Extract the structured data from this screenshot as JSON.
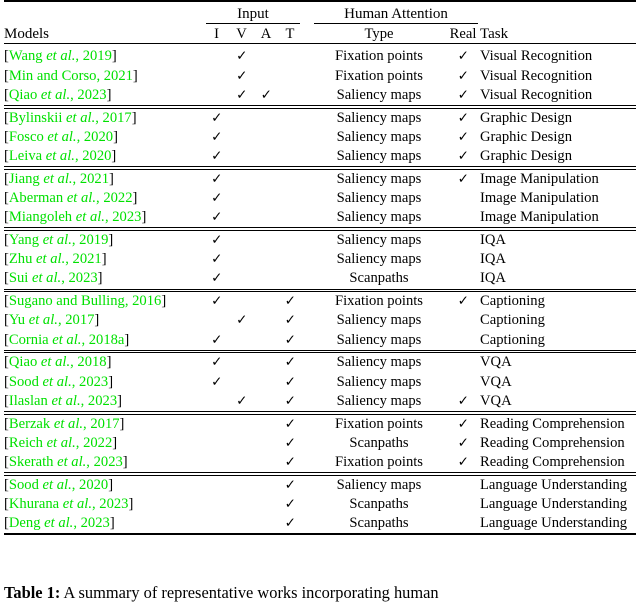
{
  "table": {
    "header": {
      "models": "Models",
      "input_group": "Input",
      "attention_group": "Human Attention",
      "input_cols": [
        "I",
        "V",
        "A",
        "T"
      ],
      "type": "Type",
      "real": "Real",
      "task": "Task"
    },
    "check_glyph": "✓",
    "citation_color": "#00e000",
    "groups": [
      {
        "rows": [
          {
            "cite_open": "[",
            "author": "Wang ",
            "etal": "et al.",
            "year": ", 2019",
            "cite_close": "]",
            "I": false,
            "V": true,
            "A": false,
            "T": false,
            "type": "Fixation points",
            "real": true,
            "task": "Visual Recognition"
          },
          {
            "cite_open": "[",
            "author": "Min and Corso",
            "etal": "",
            "year": ", 2021",
            "cite_close": "]",
            "I": false,
            "V": true,
            "A": false,
            "T": false,
            "type": "Fixation points",
            "real": true,
            "task": "Visual Recognition"
          },
          {
            "cite_open": "[",
            "author": "Qiao ",
            "etal": "et al.",
            "year": ", 2023",
            "cite_close": "]",
            "I": false,
            "V": true,
            "A": true,
            "T": false,
            "type": "Saliency maps",
            "real": true,
            "task": "Visual Recognition"
          }
        ]
      },
      {
        "rows": [
          {
            "cite_open": "[",
            "author": "Bylinskii ",
            "etal": "et al.",
            "year": ", 2017",
            "cite_close": "]",
            "I": true,
            "V": false,
            "A": false,
            "T": false,
            "type": "Saliency maps",
            "real": true,
            "task": "Graphic Design"
          },
          {
            "cite_open": "[",
            "author": "Fosco ",
            "etal": "et al.",
            "year": ", 2020",
            "cite_close": "]",
            "I": true,
            "V": false,
            "A": false,
            "T": false,
            "type": "Saliency maps",
            "real": true,
            "task": "Graphic Design"
          },
          {
            "cite_open": "[",
            "author": "Leiva ",
            "etal": "et al.",
            "year": ", 2020",
            "cite_close": "]",
            "I": true,
            "V": false,
            "A": false,
            "T": false,
            "type": "Saliency maps",
            "real": true,
            "task": "Graphic Design"
          }
        ]
      },
      {
        "rows": [
          {
            "cite_open": "[",
            "author": "Jiang ",
            "etal": "et al.",
            "year": ", 2021",
            "cite_close": "]",
            "I": true,
            "V": false,
            "A": false,
            "T": false,
            "type": "Saliency maps",
            "real": true,
            "task": "Image Manipulation"
          },
          {
            "cite_open": "[",
            "author": "Aberman ",
            "etal": "et al.",
            "year": ", 2022",
            "cite_close": "]",
            "I": true,
            "V": false,
            "A": false,
            "T": false,
            "type": "Saliency maps",
            "real": false,
            "task": "Image Manipulation"
          },
          {
            "cite_open": "[",
            "author": "Miangoleh ",
            "etal": "et al.",
            "year": ", 2023",
            "cite_close": "]",
            "I": true,
            "V": false,
            "A": false,
            "T": false,
            "type": "Saliency maps",
            "real": false,
            "task": "Image Manipulation"
          }
        ]
      },
      {
        "rows": [
          {
            "cite_open": "[",
            "author": "Yang ",
            "etal": "et al.",
            "year": ", 2019",
            "cite_close": "]",
            "I": true,
            "V": false,
            "A": false,
            "T": false,
            "type": "Saliency maps",
            "real": false,
            "task": "IQA"
          },
          {
            "cite_open": "[",
            "author": "Zhu ",
            "etal": "et al.",
            "year": ", 2021",
            "cite_close": "]",
            "I": true,
            "V": false,
            "A": false,
            "T": false,
            "type": "Saliency maps",
            "real": false,
            "task": "IQA"
          },
          {
            "cite_open": "[",
            "author": "Sui ",
            "etal": "et al.",
            "year": ", 2023",
            "cite_close": "]",
            "I": true,
            "V": false,
            "A": false,
            "T": false,
            "type": "Scanpaths",
            "real": false,
            "task": "IQA"
          }
        ]
      },
      {
        "rows": [
          {
            "cite_open": "[",
            "author": "Sugano and Bulling",
            "etal": "",
            "year": ", 2016",
            "cite_close": "]",
            "I": true,
            "V": false,
            "A": false,
            "T": true,
            "type": "Fixation points",
            "real": true,
            "task": "Captioning"
          },
          {
            "cite_open": "[",
            "author": "Yu ",
            "etal": "et al.",
            "year": ", 2017",
            "cite_close": "]",
            "I": false,
            "V": true,
            "A": false,
            "T": true,
            "type": "Saliency maps",
            "real": false,
            "task": "Captioning"
          },
          {
            "cite_open": "[",
            "author": "Cornia ",
            "etal": "et al.",
            "year": ", 2018a",
            "cite_close": "]",
            "I": true,
            "V": false,
            "A": false,
            "T": true,
            "type": "Saliency maps",
            "real": false,
            "task": "Captioning"
          }
        ]
      },
      {
        "rows": [
          {
            "cite_open": "[",
            "author": "Qiao ",
            "etal": "et al.",
            "year": ", 2018",
            "cite_close": "]",
            "I": true,
            "V": false,
            "A": false,
            "T": true,
            "type": "Saliency maps",
            "real": false,
            "task": "VQA"
          },
          {
            "cite_open": "[",
            "author": "Sood ",
            "etal": "et al.",
            "year": ", 2023",
            "cite_close": "]",
            "I": true,
            "V": false,
            "A": false,
            "T": true,
            "type": "Saliency maps",
            "real": false,
            "task": "VQA"
          },
          {
            "cite_open": "[",
            "author": "Ilaslan ",
            "etal": "et al.",
            "year": ", 2023",
            "cite_close": "]",
            "I": false,
            "V": true,
            "A": false,
            "T": true,
            "type": "Saliency maps",
            "real": true,
            "task": "VQA"
          }
        ]
      },
      {
        "rows": [
          {
            "cite_open": "[",
            "author": "Berzak ",
            "etal": "et al.",
            "year": ", 2017",
            "cite_close": "]",
            "I": false,
            "V": false,
            "A": false,
            "T": true,
            "type": "Fixation points",
            "real": true,
            "task": "Reading Comprehension"
          },
          {
            "cite_open": "[",
            "author": "Reich ",
            "etal": "et al.",
            "year": ", 2022",
            "cite_close": "]",
            "I": false,
            "V": false,
            "A": false,
            "T": true,
            "type": "Scanpaths",
            "real": true,
            "task": "Reading Comprehension"
          },
          {
            "cite_open": "[",
            "author": "Skerath ",
            "etal": "et al.",
            "year": ", 2023",
            "cite_close": "]",
            "I": false,
            "V": false,
            "A": false,
            "T": true,
            "type": "Fixation points",
            "real": true,
            "task": "Reading Comprehension"
          }
        ]
      },
      {
        "rows": [
          {
            "cite_open": "[",
            "author": "Sood ",
            "etal": "et al.",
            "year": ", 2020",
            "cite_close": "]",
            "I": false,
            "V": false,
            "A": false,
            "T": true,
            "type": "Saliency maps",
            "real": false,
            "task": "Language Understanding"
          },
          {
            "cite_open": "[",
            "author": "Khurana ",
            "etal": "et al.",
            "year": ", 2023",
            "cite_close": "]",
            "I": false,
            "V": false,
            "A": false,
            "T": true,
            "type": "Scanpaths",
            "real": false,
            "task": "Language Understanding"
          },
          {
            "cite_open": "[",
            "author": "Deng ",
            "etal": "et al.",
            "year": ", 2023",
            "cite_close": "]",
            "I": false,
            "V": false,
            "A": false,
            "T": true,
            "type": "Scanpaths",
            "real": false,
            "task": "Language Understanding"
          }
        ]
      }
    ]
  },
  "caption": {
    "label": "Table 1:",
    "text": " A summary of representative works incorporating human"
  }
}
